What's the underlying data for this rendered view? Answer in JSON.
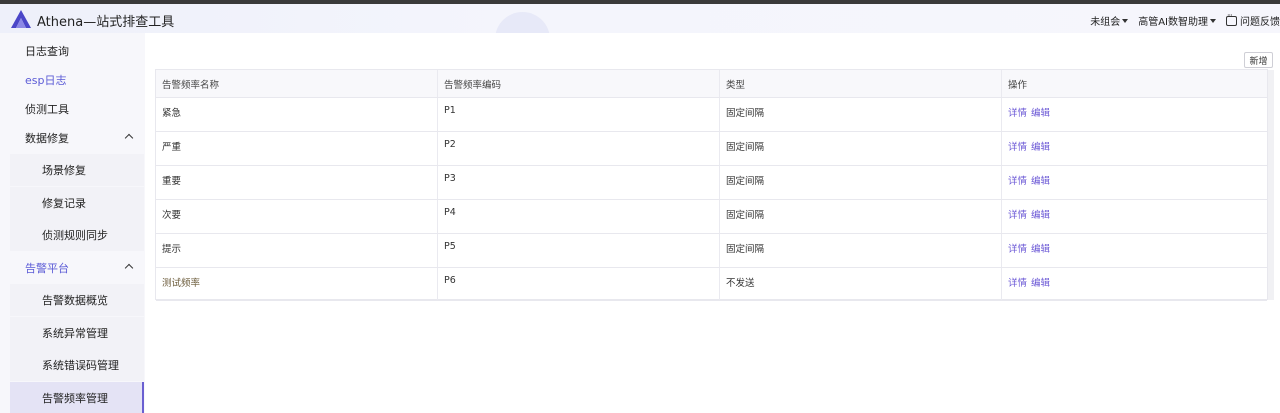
{
  "app": {
    "title": "Athena—站式排查工具"
  },
  "header": {
    "group_select": "未组会",
    "ai_assistant": "高管AI数智助理",
    "feedback": "问题反馈"
  },
  "sidebar": {
    "items": [
      {
        "label": "日志查询"
      },
      {
        "label": "esp日志"
      },
      {
        "label": "侦测工具"
      },
      {
        "label": "数据修复"
      },
      {
        "label": "场景修复"
      },
      {
        "label": "修复记录"
      },
      {
        "label": "侦测规则同步"
      },
      {
        "label": "告警平台"
      },
      {
        "label": "告警数据概览"
      },
      {
        "label": "系统异常管理"
      },
      {
        "label": "系统错误码管理"
      },
      {
        "label": "告警频率管理"
      }
    ]
  },
  "toolbar": {
    "add_label": "新增"
  },
  "table": {
    "headers": [
      "告警频率名称",
      "告警频率编码",
      "类型",
      "操作"
    ],
    "rows": [
      {
        "name": "紧急",
        "code": "P1",
        "type": "固定间隔"
      },
      {
        "name": "严重",
        "code": "P2",
        "type": "固定间隔"
      },
      {
        "name": "重要",
        "code": "P3",
        "type": "固定间隔"
      },
      {
        "name": "次要",
        "code": "P4",
        "type": "固定间隔"
      },
      {
        "name": "提示",
        "code": "P5",
        "type": "固定间隔"
      },
      {
        "name": "测试频率",
        "code": "P6",
        "type": "不发送"
      }
    ],
    "actions": {
      "detail": "详情",
      "edit": "编辑"
    }
  }
}
